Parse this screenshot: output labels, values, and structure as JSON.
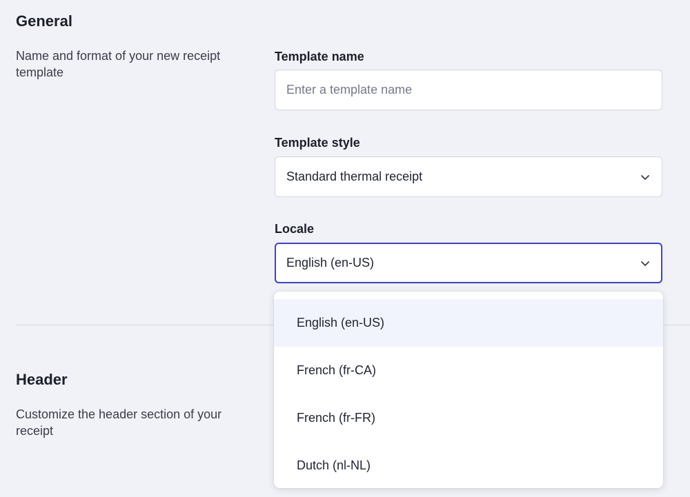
{
  "general": {
    "title": "General",
    "description": "Name and format of your new receipt template",
    "template_name": {
      "label": "Template name",
      "value": "",
      "placeholder": "Enter a template name"
    },
    "template_style": {
      "label": "Template style",
      "selected": "Standard thermal receipt"
    },
    "locale": {
      "label": "Locale",
      "selected": "English (en-US)",
      "options": [
        "English (en-US)",
        "French (fr-CA)",
        "French (fr-FR)",
        "Dutch (nl-NL)"
      ]
    }
  },
  "header": {
    "title": "Header",
    "description": "Customize the header section of your receipt"
  },
  "colors": {
    "background": "#f1f2f7",
    "focus_border": "#3b3fd8",
    "active_option": "#f2f4fd"
  },
  "icons": {
    "select_chevron": "chevron-down-icon"
  }
}
